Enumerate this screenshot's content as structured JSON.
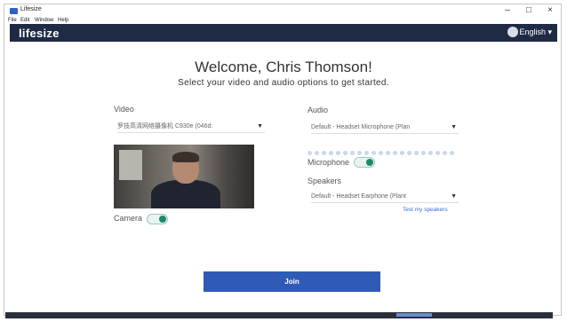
{
  "window": {
    "title": "Lifesize",
    "menu": [
      "File",
      "Edit",
      "Window",
      "Help"
    ],
    "controls": {
      "minimize": "–",
      "maximize": "□",
      "close": "×"
    }
  },
  "header": {
    "logo": "lifesize",
    "language": "English ▾"
  },
  "welcome": {
    "title": "Welcome, Chris Thomson!",
    "subtitle": "Select your video and audio options to get started."
  },
  "video": {
    "label": "Video",
    "device": "罗技高清网络摄像机 C930e (046d:",
    "camera_label": "Camera",
    "camera_on": true
  },
  "audio": {
    "label": "Audio",
    "microphone_device": "Default - Headset Microphone (Plan",
    "microphone_label": "Microphone",
    "microphone_on": true,
    "speakers_label": "Speakers",
    "speakers_device": "Default - Headset Earphone (Plant",
    "test_speakers": "Test my speakers"
  },
  "join_label": "Join"
}
